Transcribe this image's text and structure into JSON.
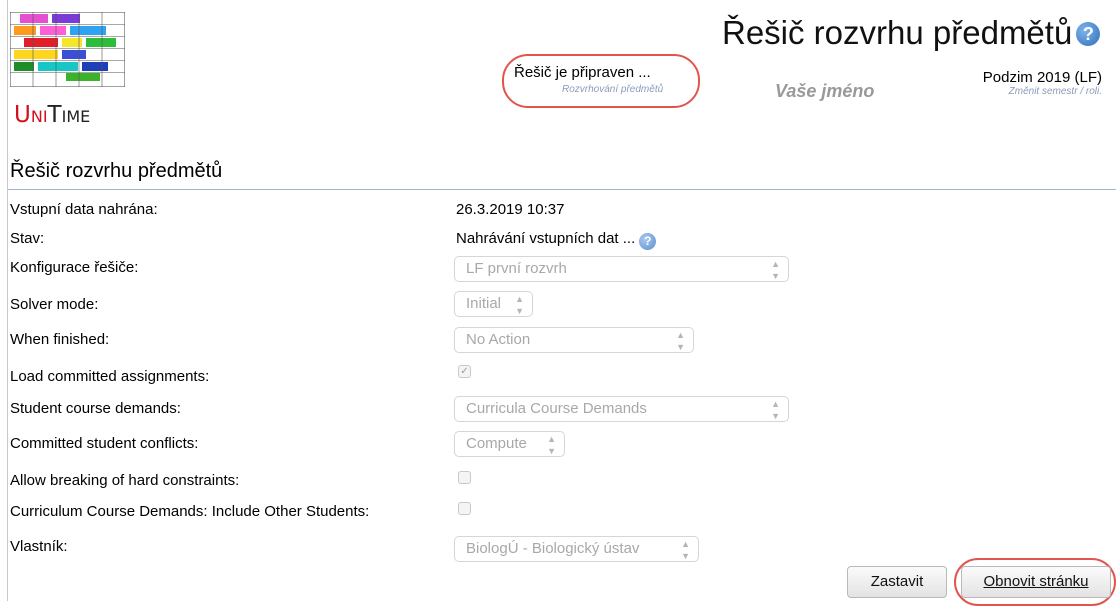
{
  "logo": {
    "text_u": "U",
    "text_ni": "NI",
    "text_t": "T",
    "text_ime": "IME"
  },
  "header": {
    "app_title": "Řešič rozvrhu předmětů",
    "help_icon": "help-circle-icon",
    "status_title": "Řešič je připraven ...",
    "status_sub": "Rozvrhování předmětů",
    "user_name": "Vaše jméno",
    "session": "Podzim 2019 (LF)",
    "session_sub": "Změnit semestr / roli."
  },
  "page_title": "Řešič rozvrhu předmětů",
  "rows": {
    "data_loaded": {
      "label": "Vstupní data nahrána:",
      "value": "26.3.2019 10:37"
    },
    "status": {
      "label": "Stav:",
      "value": "Nahrávání vstupních dat ..."
    },
    "config": {
      "label": "Konfigurace řešiče:",
      "value": "LF první rozvrh"
    },
    "mode": {
      "label": "Solver mode:",
      "value": "Initial"
    },
    "finished": {
      "label": "When finished:",
      "value": "No Action"
    },
    "load_committed": {
      "label": "Load committed assignments:",
      "checked": true
    },
    "demands": {
      "label": "Student course demands:",
      "value": "Curricula Course Demands"
    },
    "conflicts": {
      "label": "Committed student conflicts:",
      "value": "Compute"
    },
    "breaking": {
      "label": "Allow breaking of hard constraints:",
      "checked": false
    },
    "curriculum": {
      "label": "Curriculum Course Demands: Include Other Students:",
      "checked": false
    },
    "owner": {
      "label": "Vlastník:",
      "value": "BiologÚ - Biologický ústav"
    }
  },
  "buttons": {
    "stop": "Zastavit",
    "refresh": "Obnovit stránku"
  },
  "colors": {
    "highlight": "#e2554f",
    "accent": "#2e6fbd",
    "logo_red": "#d4101f"
  }
}
